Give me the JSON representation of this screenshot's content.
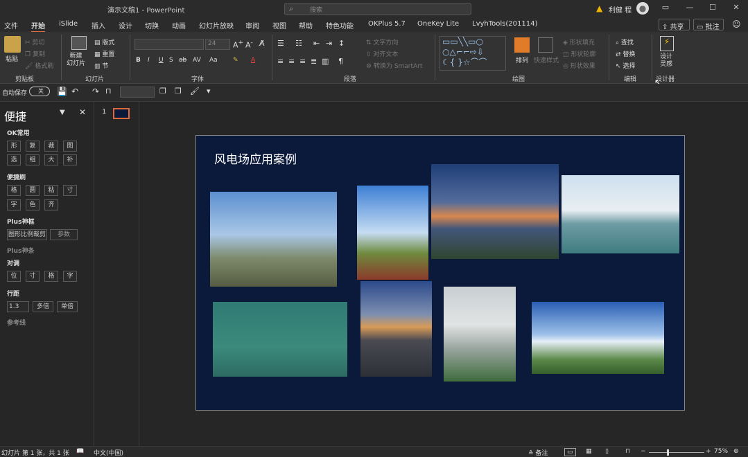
{
  "window": {
    "doc_title": "演示文稿1 - PowerPoint",
    "search_placeholder": "搜索",
    "user_name": "利健 程"
  },
  "tabs": [
    "文件",
    "开始",
    "iSlide",
    "插入",
    "设计",
    "切换",
    "动画",
    "幻灯片放映",
    "审阅",
    "视图",
    "帮助",
    "特色功能",
    "OKPlus 5.7",
    "OneKey Lite",
    "LvyhTools(201114)"
  ],
  "active_tab": "开始",
  "share_label": "共享",
  "comment_label": "批注",
  "ribbon": {
    "groups": [
      "剪贴板",
      "幻灯片",
      "字体",
      "段落",
      "绘图",
      "编辑",
      "设计器"
    ],
    "clipboard": {
      "paste": "粘贴",
      "cut": "剪切",
      "copy": "复制",
      "format_painter": "格式刷"
    },
    "slides": {
      "new_slide": "新建\n幻灯片",
      "layout": "版式",
      "reset": "重置",
      "section": "节"
    },
    "font": {
      "size": "24"
    },
    "paragraph": {
      "text_direction": "文字方向",
      "align_text": "对齐文本",
      "smartart": "转换为 SmartArt"
    },
    "drawing": {
      "arrange": "排列",
      "quick_styles": "快速样式",
      "shape_fill": "形状填充",
      "shape_outline": "形状轮廓",
      "shape_effects": "形状效果"
    },
    "editing": {
      "find": "查找",
      "replace": "替换",
      "select": "选择"
    },
    "designer": {
      "design_ideas": "设计\n灵感"
    }
  },
  "qat": {
    "autosave": "自动保存",
    "autosave_state": "关"
  },
  "panel": {
    "title": "便捷",
    "sections": [
      {
        "name": "OK常用",
        "rows": [
          [
            "形",
            "复",
            "裁",
            "图"
          ],
          [
            "选",
            "组",
            "大",
            "补"
          ]
        ]
      },
      {
        "name": "便捷刷",
        "rows": [
          [
            "格",
            "圆",
            "粘",
            "寸"
          ],
          [
            "字",
            "色",
            "齐"
          ]
        ]
      },
      {
        "name": "Plus神框",
        "rows": [
          [
            "图形比例裁剪",
            "参数"
          ]
        ]
      },
      {
        "name": "Plus神条",
        "rows": []
      },
      {
        "name": "对调",
        "rows": [
          [
            "位",
            "寸",
            "格",
            "字"
          ]
        ]
      },
      {
        "name": "行距",
        "rows": [
          [
            "1.3",
            "多倍",
            "单倍"
          ]
        ]
      },
      {
        "name": "参考线",
        "rows": []
      }
    ]
  },
  "thumbnail": {
    "number": "1"
  },
  "slide": {
    "title": "风电场应用案例"
  },
  "status": {
    "slide_info": "幻灯片 第 1 张，共 1 张",
    "language": "中文(中国)",
    "notes": "备注",
    "zoom": "75%"
  },
  "colors": {
    "accent": "#e06a3b",
    "slide_bg": "#0b1a3a"
  }
}
